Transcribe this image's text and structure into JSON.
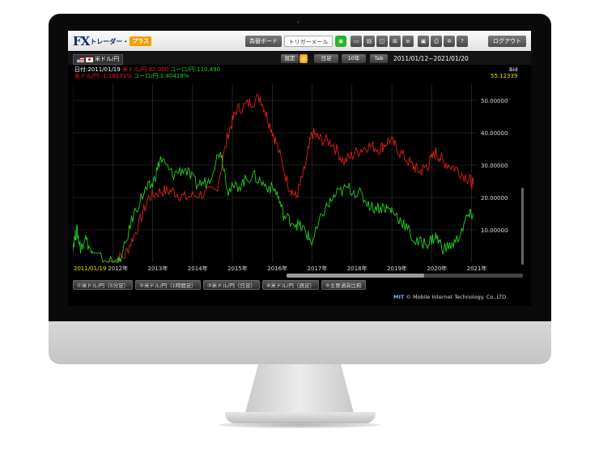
{
  "app": {
    "logo_fx": "FX",
    "logo_trader": "トレーダー・",
    "logo_plus": "プラス"
  },
  "toolbar": {
    "board_button": "為替ボード",
    "trigger_mail": "トリガーメール",
    "line_icon": "line-icon",
    "logout_button": "ログアウト"
  },
  "chart_header": {
    "pair": "米ドル/円",
    "settings": "設定",
    "period": "日足",
    "span": "10年",
    "tab": "Tab",
    "date_range": "2011/01/12~2021/01/20"
  },
  "legend": {
    "date": "日付:2011/01/19",
    "usd_rsi": "米ドル/円:82.000",
    "eur_rsi": "ユーロ/円:110.490",
    "usd_change": "米ドル/円:-1.18101%",
    "eur_change": "ユーロ/円:1.40419%"
  },
  "bid_label": "Bid",
  "bid_value": "55.12339",
  "tabs": [
    "①米ドル/円（5分足）",
    "②米ドル/円（1時間足）",
    "③米ドル/円（日足）",
    "④米ドル/円（週足）",
    "⑤主要通貨比較"
  ],
  "copyright_mark": "MIT",
  "copyright": "© Mobile Internet Technology. Co.,LTD.",
  "colors": {
    "usd_series": "#e0201a",
    "eur_series": "#22d022",
    "grid": "#3a3a3a",
    "bid": "#f0e000"
  },
  "chart_data": {
    "type": "line",
    "x": [
      "2011",
      "2012",
      "2013",
      "2014",
      "2015",
      "2016",
      "2017",
      "2018",
      "2019",
      "2020",
      "2021"
    ],
    "x_tick_labels": [
      "2011/01/19",
      "2012年",
      "2013年",
      "2014年",
      "2015年",
      "2016年",
      "2017年",
      "2018年",
      "2019年",
      "2020年",
      "2021年"
    ],
    "y_tick_labels": [
      "50.00000",
      "40.00000",
      "30.00000",
      "20.00000",
      "10.00000"
    ],
    "ylim": [
      0,
      55
    ],
    "grid": true,
    "series": [
      {
        "name": "米ドル/円",
        "x": [
          2011.9,
          2012.3,
          2012.6,
          2012.9,
          2013.2,
          2013.5,
          2013.8,
          2014.2,
          2014.6,
          2014.9,
          2015.1,
          2015.4,
          2015.7,
          2015.9,
          2016.1,
          2016.4,
          2016.6,
          2016.8,
          2017.0,
          2017.2,
          2017.5,
          2017.8,
          2018.1,
          2018.4,
          2018.7,
          2018.95,
          2019.2,
          2019.5,
          2019.7,
          2019.9,
          2020.1,
          2020.3,
          2020.6,
          2020.9,
          2021.05
        ],
        "values": [
          0.0,
          2.0,
          10.0,
          20.0,
          22.0,
          22.0,
          20.0,
          21.0,
          22.0,
          40.0,
          47.0,
          49.0,
          51.0,
          44.0,
          37.0,
          24.0,
          20.0,
          28.0,
          40.0,
          38.0,
          37.0,
          31.0,
          34.0,
          36.0,
          35.0,
          38.0,
          34.0,
          30.0,
          28.0,
          30.0,
          34.0,
          31.0,
          29.0,
          26.0,
          24.0
        ]
      },
      {
        "name": "ユーロ/円",
        "x": [
          2011.0,
          2011.1,
          2011.2,
          2011.3,
          2011.5,
          2012.0,
          2012.2,
          2012.5,
          2012.8,
          2013.0,
          2013.2,
          2013.5,
          2013.8,
          2014.1,
          2014.4,
          2014.7,
          2014.9,
          2015.2,
          2015.5,
          2015.8,
          2016.1,
          2016.3,
          2016.6,
          2016.8,
          2017.0,
          2017.3,
          2017.6,
          2017.9,
          2018.2,
          2018.5,
          2018.8,
          2019.0,
          2019.3,
          2019.6,
          2019.9,
          2020.1,
          2020.3,
          2020.6,
          2020.9,
          2021.05
        ],
        "values": [
          5.0,
          10.0,
          4.0,
          8.0,
          2.0,
          0.0,
          0.0,
          14.0,
          22.0,
          24.0,
          32.0,
          27.0,
          29.0,
          24.0,
          25.0,
          35.0,
          22.0,
          24.0,
          27.0,
          24.0,
          22.0,
          14.0,
          12.0,
          10.0,
          6.0,
          16.0,
          21.0,
          23.0,
          21.0,
          17.0,
          17.0,
          16.0,
          12.0,
          6.0,
          6.0,
          8.0,
          4.0,
          6.0,
          14.0,
          15.0
        ]
      }
    ]
  }
}
